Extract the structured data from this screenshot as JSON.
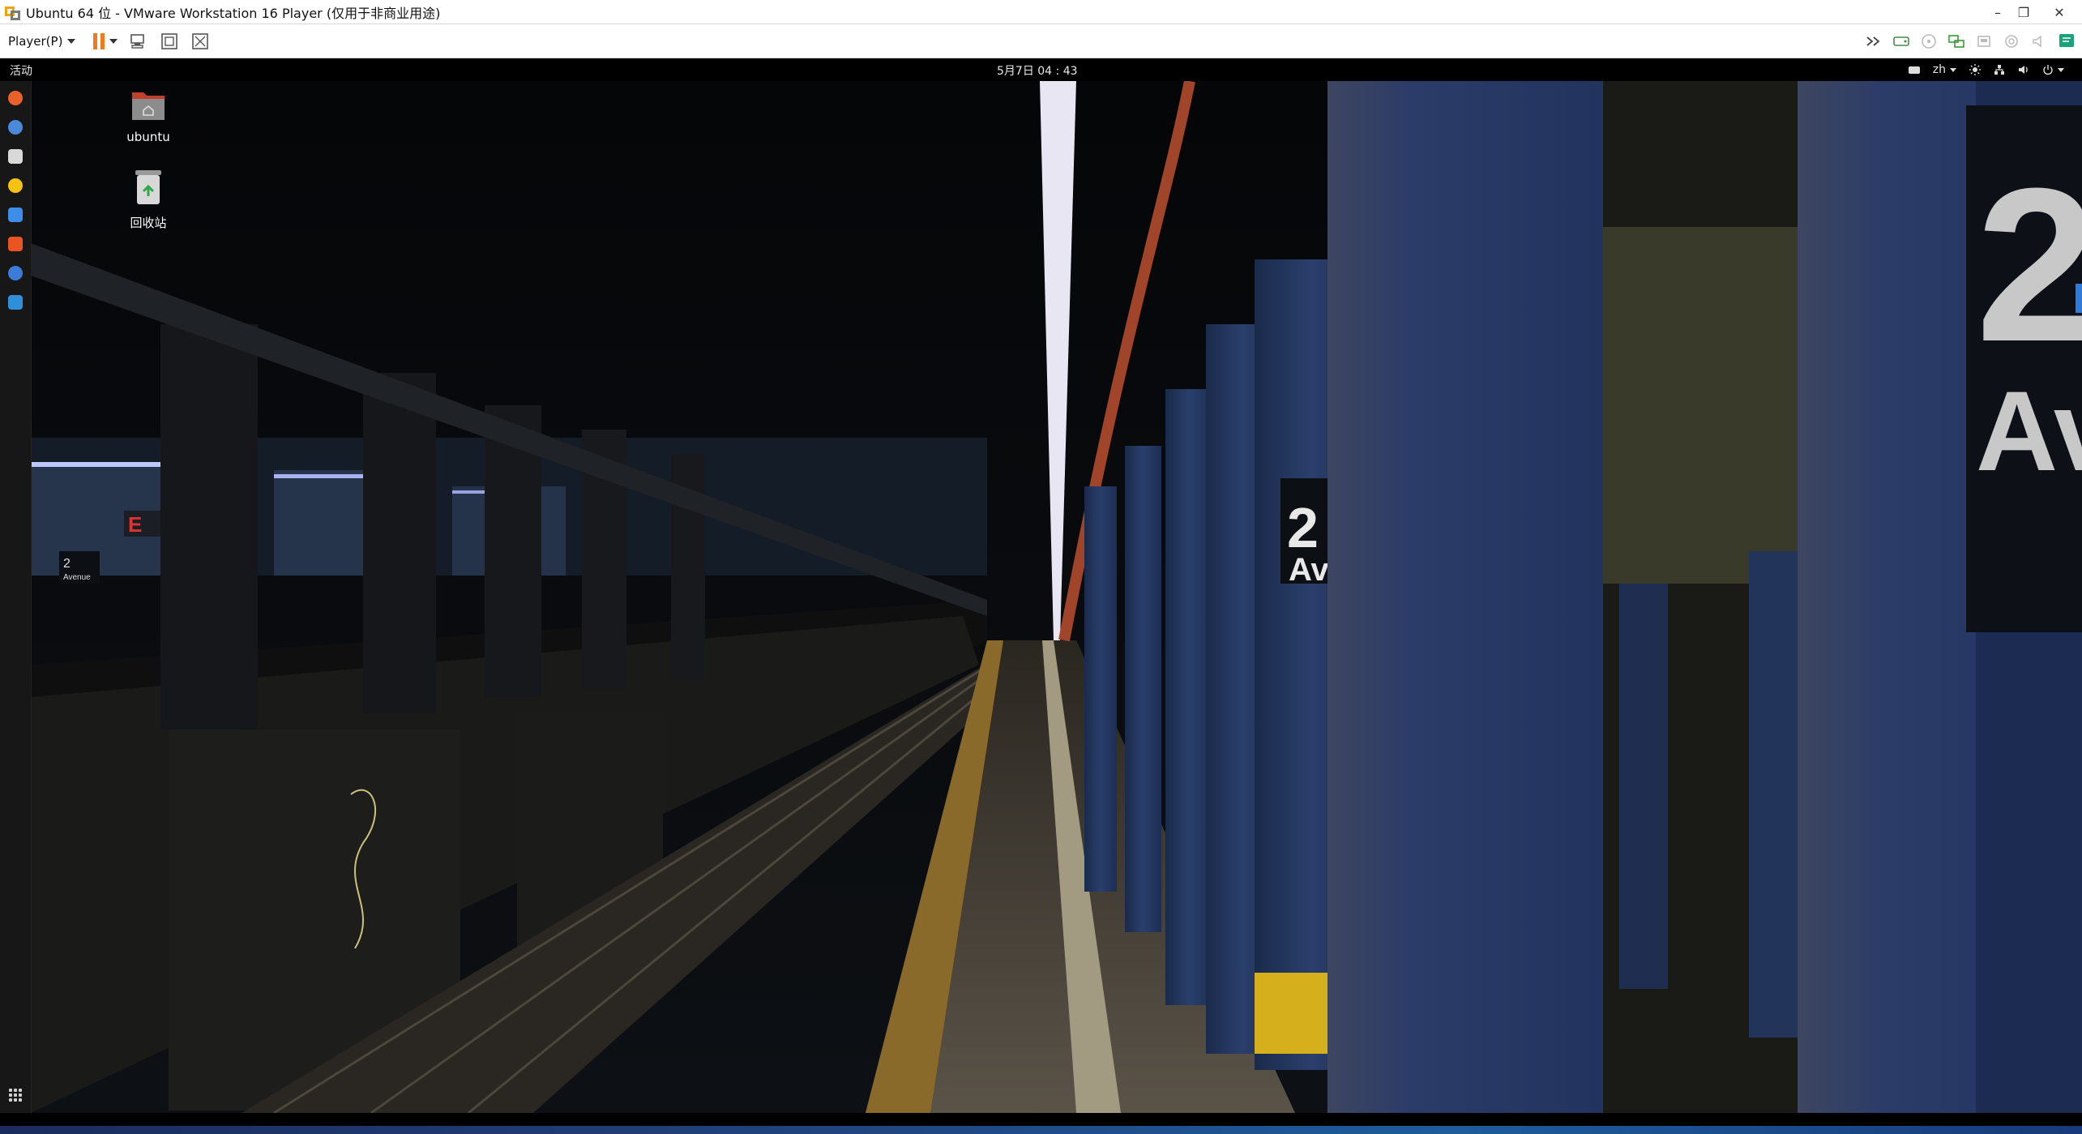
{
  "window": {
    "title": "Ubuntu 64 位 - VMware Workstation 16 Player (仅用于非商业用途)",
    "controls": [
      "minimize-icon",
      "restore-icon",
      "close-icon"
    ],
    "control_glyphs": {
      "minimize": "–",
      "restore": "❐",
      "close": "✕"
    }
  },
  "toolbar": {
    "player_menu_label": "Player(P)",
    "left_icons": [
      "pause-icon",
      "send-ctrl-alt-del-icon",
      "fullscreen-icon",
      "unity-icon"
    ],
    "right_icons": [
      "more-icon",
      "hard-disk-icon",
      "cd-icon",
      "network-icon",
      "usb-icon",
      "printer-icon",
      "sound-icon",
      "camera-icon",
      "speaker-icon",
      "message-icon"
    ],
    "accent_color": "#f07a1c"
  },
  "gnome": {
    "activities_label": "活动",
    "clock": "5月7日  04 : 43",
    "input_method": "zh",
    "tray_icons": [
      "keyboard-icon",
      "brightness-icon",
      "network-wired-icon",
      "volume-icon",
      "power-icon"
    ]
  },
  "dock": {
    "items": [
      {
        "name": "firefox",
        "color": "#e8602a"
      },
      {
        "name": "thunderbird",
        "color": "#4a8ad8"
      },
      {
        "name": "files",
        "color": "#d9d9d9"
      },
      {
        "name": "rhythmbox",
        "color": "#f5c211"
      },
      {
        "name": "writer",
        "color": "#3c8ee8"
      },
      {
        "name": "software",
        "color": "#e95420"
      },
      {
        "name": "help",
        "color": "#3d7bd8"
      },
      {
        "name": "vscode",
        "color": "#2f8fd8"
      }
    ]
  },
  "desktop": {
    "icons": [
      {
        "label": "ubuntu",
        "icon": "home-folder-icon"
      },
      {
        "label": "回收站",
        "icon": "trash-icon"
      }
    ]
  },
  "wallpaper": {
    "signs": {
      "number": "2",
      "avenue": "Avenue",
      "big_sign_top": "2",
      "big_sign_bottom": "Ave",
      "mid_sign_top": "2",
      "mid_sign_bottom": "Ave",
      "exit": "E"
    }
  }
}
